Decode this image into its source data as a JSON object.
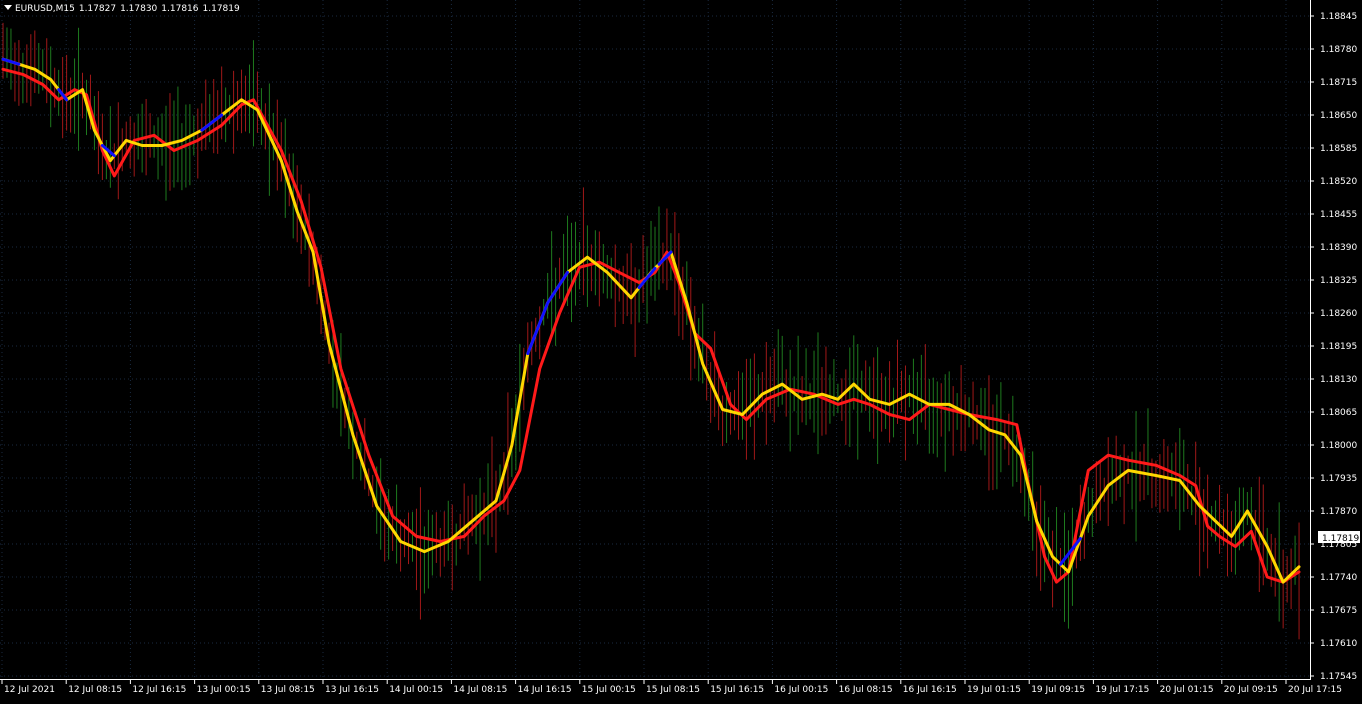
{
  "header": {
    "symbol": "EURUSD,M15",
    "open": "1.17827",
    "high": "1.17830",
    "low": "1.17816",
    "close": "1.17819"
  },
  "current_price_label": "1.17819",
  "colors": {
    "background": "#000000",
    "axis": "#ffffff",
    "grid": "#1a2a40",
    "bull_candle": "#1e7a1e",
    "bear_candle": "#a01818",
    "slow_ma": "#ff1a1a",
    "fast_ma": "#ffd700",
    "fast_ma_up": "#1010ff",
    "price_label_bg": "#ffffff",
    "price_label_text": "#000000"
  },
  "chart_data": {
    "type": "line",
    "title": "EURUSD,M15",
    "y_ticks": [
      "1.18845",
      "1.18780",
      "1.18715",
      "1.18650",
      "1.18585",
      "1.18520",
      "1.18455",
      "1.18390",
      "1.18325",
      "1.18260",
      "1.18195",
      "1.18130",
      "1.18065",
      "1.18000",
      "1.17935",
      "1.17870",
      "1.17805",
      "1.17740",
      "1.17675",
      "1.17610",
      "1.17545"
    ],
    "x_ticks": [
      "12 Jul 2021",
      "12 Jul 08:15",
      "12 Jul 16:15",
      "13 Jul 00:15",
      "13 Jul 08:15",
      "13 Jul 16:15",
      "14 Jul 00:15",
      "14 Jul 08:15",
      "14 Jul 16:15",
      "15 Jul 00:15",
      "15 Jul 08:15",
      "15 Jul 16:15",
      "16 Jul 00:15",
      "16 Jul 08:15",
      "16 Jul 16:15",
      "19 Jul 01:15",
      "19 Jul 09:15",
      "19 Jul 17:15",
      "20 Jul 01:15",
      "20 Jul 09:15",
      "20 Jul 17:15"
    ],
    "ylim": [
      1.175,
      1.189
    ],
    "grid": true,
    "series": [
      {
        "color": "#ff1a1a",
        "points": [
          [
            0,
            1.1874
          ],
          [
            5,
            1.1873
          ],
          [
            10,
            1.1871
          ],
          [
            14,
            1.1868
          ],
          [
            18,
            1.187
          ],
          [
            21,
            1.1869
          ],
          [
            25,
            1.1858
          ],
          [
            28,
            1.1853
          ],
          [
            33,
            1.186
          ],
          [
            38,
            1.1861
          ],
          [
            43,
            1.1858
          ],
          [
            49,
            1.186
          ],
          [
            55,
            1.1863
          ],
          [
            60,
            1.1867
          ],
          [
            63,
            1.1868
          ],
          [
            70,
            1.1858
          ],
          [
            75,
            1.1848
          ],
          [
            80,
            1.1835
          ],
          [
            85,
            1.1815
          ],
          [
            92,
            1.1798
          ],
          [
            98,
            1.1786
          ],
          [
            104,
            1.1782
          ],
          [
            110,
            1.1781
          ],
          [
            116,
            1.1782
          ],
          [
            121,
            1.1786
          ],
          [
            126,
            1.1789
          ],
          [
            130,
            1.1795
          ],
          [
            135,
            1.1815
          ],
          [
            140,
            1.1826
          ],
          [
            145,
            1.1835
          ],
          [
            150,
            1.1836
          ],
          [
            155,
            1.1834
          ],
          [
            160,
            1.1832
          ],
          [
            164,
            1.1834
          ],
          [
            167,
            1.1838
          ],
          [
            170,
            1.1832
          ],
          [
            174,
            1.1822
          ],
          [
            178,
            1.1819
          ],
          [
            183,
            1.1808
          ],
          [
            187,
            1.1805
          ],
          [
            192,
            1.1809
          ],
          [
            198,
            1.1811
          ],
          [
            204,
            1.181
          ],
          [
            210,
            1.1808
          ],
          [
            214,
            1.1809
          ],
          [
            218,
            1.1808
          ],
          [
            223,
            1.1806
          ],
          [
            228,
            1.1805
          ],
          [
            233,
            1.1808
          ],
          [
            238,
            1.1807
          ],
          [
            243,
            1.1806
          ],
          [
            250,
            1.1805
          ],
          [
            255,
            1.1804
          ],
          [
            258,
            1.1792
          ],
          [
            262,
            1.1778
          ],
          [
            265,
            1.1773
          ],
          [
            268,
            1.1775
          ],
          [
            273,
            1.1795
          ],
          [
            278,
            1.1798
          ],
          [
            283,
            1.1797
          ],
          [
            290,
            1.1796
          ],
          [
            296,
            1.1794
          ],
          [
            300,
            1.1792
          ],
          [
            303,
            1.1784
          ],
          [
            306,
            1.1782
          ],
          [
            310,
            1.178
          ],
          [
            314,
            1.1783
          ],
          [
            318,
            1.1774
          ],
          [
            322,
            1.1773
          ],
          [
            326,
            1.1775
          ]
        ]
      },
      {
        "color": "#ffd700",
        "points": [
          [
            0,
            1.1876
          ],
          [
            4,
            1.1875
          ],
          [
            8,
            1.1874
          ],
          [
            12,
            1.1872
          ],
          [
            16,
            1.1868
          ],
          [
            20,
            1.187
          ],
          [
            23,
            1.1862
          ],
          [
            27,
            1.1856
          ],
          [
            31,
            1.186
          ],
          [
            35,
            1.1859
          ],
          [
            40,
            1.1859
          ],
          [
            45,
            1.186
          ],
          [
            50,
            1.1862
          ],
          [
            55,
            1.1865
          ],
          [
            60,
            1.1868
          ],
          [
            64,
            1.1866
          ],
          [
            70,
            1.1856
          ],
          [
            74,
            1.1846
          ],
          [
            78,
            1.1838
          ],
          [
            82,
            1.182
          ],
          [
            88,
            1.1802
          ],
          [
            94,
            1.1788
          ],
          [
            100,
            1.1781
          ],
          [
            106,
            1.1779
          ],
          [
            112,
            1.1781
          ],
          [
            118,
            1.1785
          ],
          [
            124,
            1.1789
          ],
          [
            128,
            1.18
          ],
          [
            132,
            1.1818
          ],
          [
            137,
            1.1828
          ],
          [
            142,
            1.1834
          ],
          [
            147,
            1.1837
          ],
          [
            152,
            1.1834
          ],
          [
            158,
            1.1829
          ],
          [
            163,
            1.1834
          ],
          [
            168,
            1.1838
          ],
          [
            172,
            1.1828
          ],
          [
            176,
            1.1816
          ],
          [
            181,
            1.1807
          ],
          [
            186,
            1.1806
          ],
          [
            191,
            1.181
          ],
          [
            196,
            1.1812
          ],
          [
            201,
            1.1809
          ],
          [
            206,
            1.181
          ],
          [
            210,
            1.1809
          ],
          [
            214,
            1.1812
          ],
          [
            218,
            1.1809
          ],
          [
            223,
            1.1808
          ],
          [
            228,
            1.181
          ],
          [
            233,
            1.1808
          ],
          [
            238,
            1.1808
          ],
          [
            243,
            1.1806
          ],
          [
            248,
            1.1803
          ],
          [
            252,
            1.1802
          ],
          [
            256,
            1.1798
          ],
          [
            260,
            1.1785
          ],
          [
            264,
            1.1778
          ],
          [
            268,
            1.1775
          ],
          [
            273,
            1.1786
          ],
          [
            278,
            1.1792
          ],
          [
            283,
            1.1795
          ],
          [
            290,
            1.1794
          ],
          [
            296,
            1.1793
          ],
          [
            301,
            1.1788
          ],
          [
            305,
            1.1785
          ],
          [
            309,
            1.1782
          ],
          [
            313,
            1.1787
          ],
          [
            318,
            1.178
          ],
          [
            322,
            1.1773
          ],
          [
            326,
            1.1776
          ]
        ]
      }
    ]
  }
}
